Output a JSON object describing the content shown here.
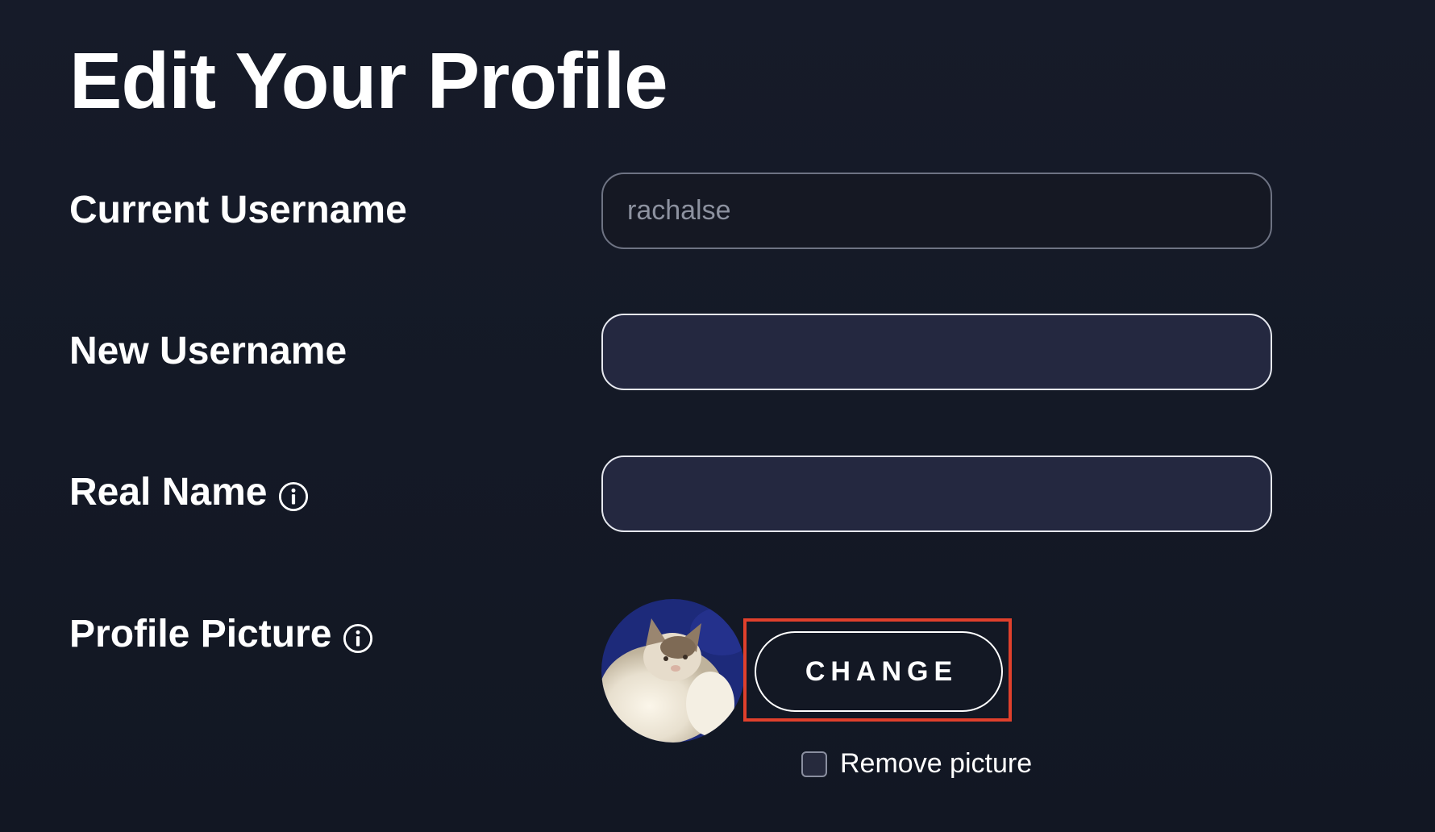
{
  "page": {
    "title": "Edit Your Profile"
  },
  "fields": {
    "current_username": {
      "label": "Current Username",
      "value": "rachalse"
    },
    "new_username": {
      "label": "New Username",
      "value": ""
    },
    "real_name": {
      "label": "Real Name",
      "value": "",
      "icon": "info-icon"
    },
    "profile_picture": {
      "label": "Profile Picture",
      "icon": "info-icon",
      "change_label": "CHANGE",
      "remove_label": "Remove picture",
      "remove_checked": false
    }
  },
  "colors": {
    "background": "#141927",
    "input_fill": "#242840",
    "highlight": "#e0402c",
    "text": "#ffffff"
  }
}
